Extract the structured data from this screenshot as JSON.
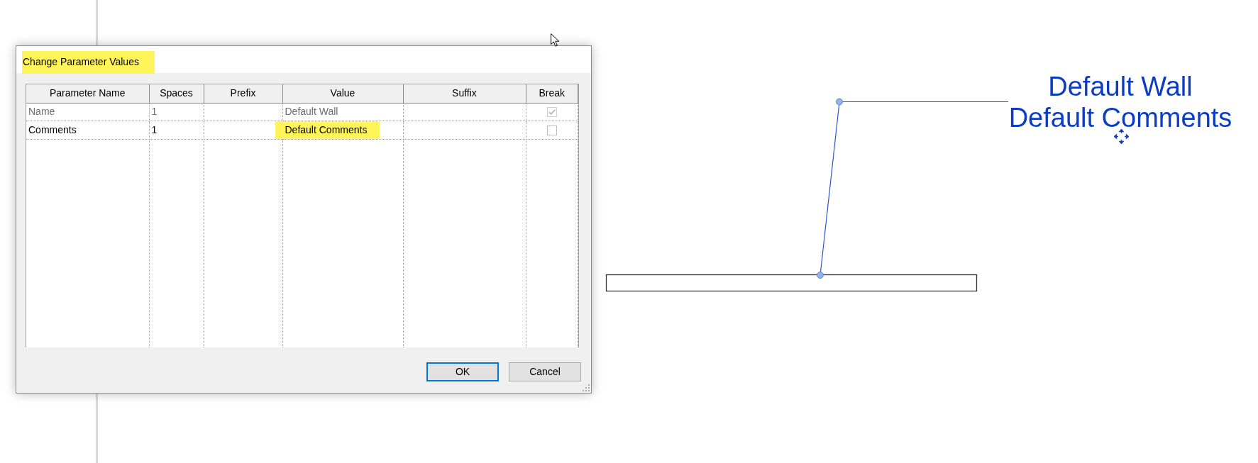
{
  "dialog": {
    "title": {
      "text": "Change Parameter Values",
      "highlighted": true
    },
    "columns": [
      "Parameter Name",
      "Spaces",
      "Prefix",
      "Value",
      "Suffix",
      "Break"
    ],
    "rows": [
      {
        "parameter_name": "Name",
        "spaces": "1",
        "value": "Default Wall",
        "break": true,
        "disabled": true,
        "value_highlighted": false
      },
      {
        "parameter_name": "Comments",
        "spaces": "1",
        "value": "Default Comments",
        "break": false,
        "disabled": false,
        "value_highlighted": true
      }
    ],
    "buttons": [
      {
        "label": "OK",
        "default": true
      },
      {
        "label": "Cancel",
        "default": false
      }
    ]
  },
  "canvas": {
    "tag": {
      "lines": [
        "Default Wall",
        "Default Comments"
      ]
    }
  }
}
